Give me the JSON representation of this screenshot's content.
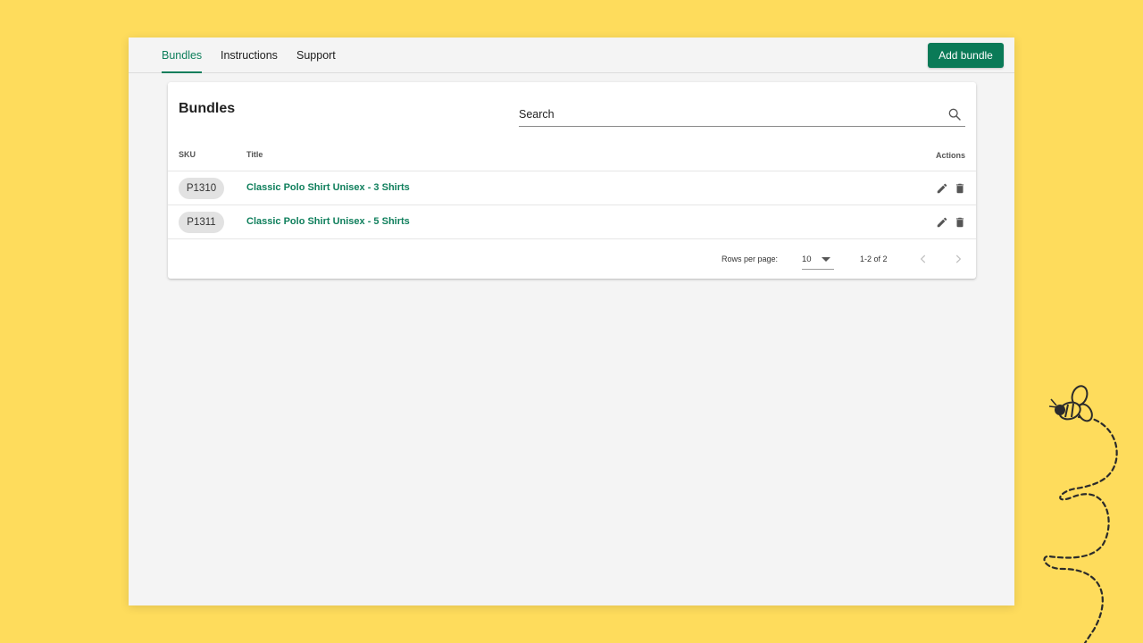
{
  "nav": {
    "tabs": [
      {
        "label": "Bundles",
        "active": true
      },
      {
        "label": "Instructions",
        "active": false
      },
      {
        "label": "Support",
        "active": false
      }
    ],
    "add_button_label": "Add bundle"
  },
  "card": {
    "title": "Bundles",
    "search_placeholder": "Search",
    "columns": {
      "sku": "SKU",
      "title": "Title",
      "actions": "Actions"
    },
    "rows": [
      {
        "sku": "P1310",
        "title": "Classic Polo Shirt Unisex - 3 Shirts"
      },
      {
        "sku": "P1311",
        "title": "Classic Polo Shirt Unisex - 5 Shirts"
      }
    ],
    "pagination": {
      "rows_per_page_label": "Rows per page:",
      "rows_per_page": "10",
      "range": "1-2 of 2"
    }
  },
  "colors": {
    "background": "#FEDC5C",
    "accent": "#0F7F5C",
    "button": "#0A7A57"
  },
  "icons": [
    "search-icon",
    "edit-icon",
    "delete-icon",
    "chevron-down-icon",
    "chevron-left-icon",
    "chevron-right-icon",
    "bee-illustration"
  ]
}
